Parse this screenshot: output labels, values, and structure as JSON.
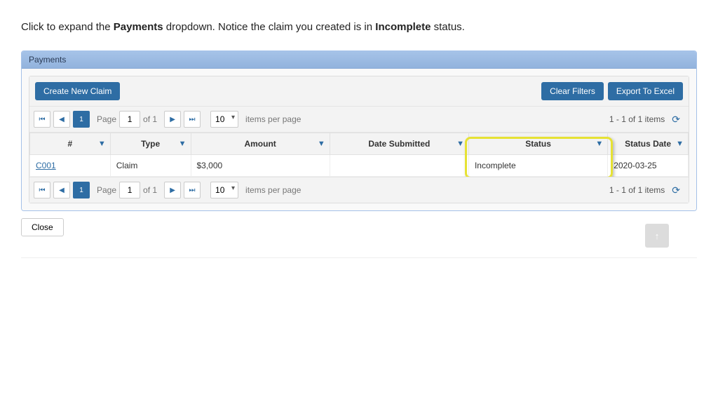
{
  "instruction": {
    "prefix": "Click to expand the ",
    "bold1": "Payments",
    "mid": " dropdown. Notice the claim you created is in ",
    "bold2": "Incomplete",
    "suffix": " status."
  },
  "panel": {
    "title": "Payments"
  },
  "toolbar": {
    "create_label": "Create New Claim",
    "clear_filters_label": "Clear Filters",
    "export_label": "Export To Excel"
  },
  "pager": {
    "page_label": "Page",
    "page_value": "1",
    "of_label": "of 1",
    "items_per_page_value": "10",
    "items_per_page_label": "items per page",
    "info": "1 - 1 of 1 items"
  },
  "columns": [
    "#",
    "Type",
    "Amount",
    "Date Submitted",
    "Status",
    "Status Date"
  ],
  "row": {
    "id": "C001",
    "type": "Claim",
    "amount": "$3,000",
    "date_submitted": "",
    "status": "Incomplete",
    "status_date": "2020-03-25"
  },
  "close_label": "Close"
}
